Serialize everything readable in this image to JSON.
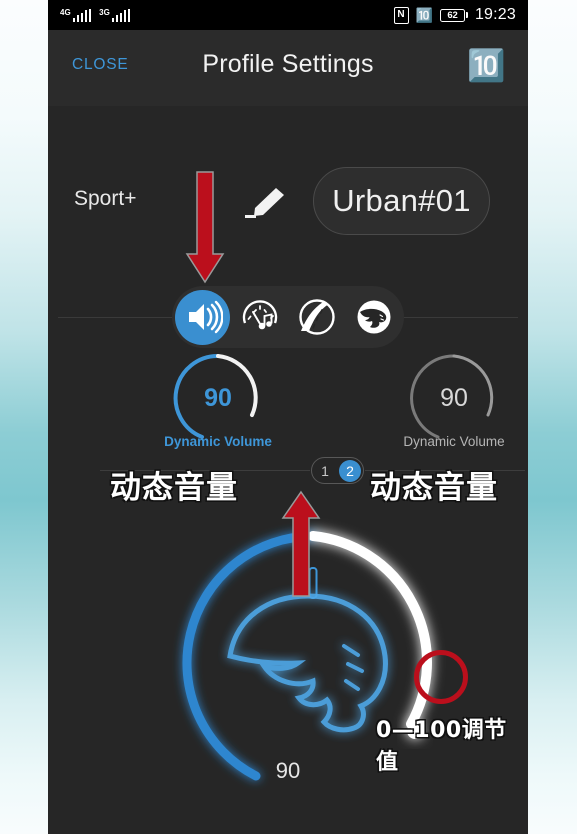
{
  "status_bar": {
    "network_1": "4G",
    "network_2": "3G",
    "nfc_label": "N",
    "bluetooth_icon": "bluetooth-icon",
    "battery_level": "62",
    "time": "19:23"
  },
  "header": {
    "close_label": "CLOSE",
    "title": "Profile Settings",
    "bluetooth_icon": "bluetooth-icon"
  },
  "profile": {
    "mode_label": "Sport+",
    "edit_icon": "pencil-icon",
    "profile_name": "Urban#01"
  },
  "tabs": [
    {
      "name": "speaker-icon",
      "label": "Volume",
      "active": true
    },
    {
      "name": "equalizer-gauge-icon",
      "label": "Sound",
      "active": false
    },
    {
      "name": "road-curve-icon",
      "label": "Road",
      "active": false
    },
    {
      "name": "panther-logo-icon",
      "label": "Brand",
      "active": false
    }
  ],
  "dials": [
    {
      "value": "90",
      "caption": "Dynamic Volume",
      "active": true
    },
    {
      "value": "90",
      "caption": "Dynamic Volume",
      "active": false
    }
  ],
  "pager": {
    "pages": [
      "1",
      "2"
    ],
    "selected": "2"
  },
  "main_dial": {
    "value": "90",
    "min": 0,
    "max": 100,
    "logo": "panther-head-logo"
  },
  "annotations": {
    "left_cn": "动态音量",
    "right_cn": "动态音量",
    "range_cn": "0—100调节值",
    "arrow_down": "red-down-arrow",
    "arrow_up": "red-up-arrow",
    "highlight_ring": "red-circle-highlight"
  },
  "colors": {
    "accent_blue": "#3a8fd0",
    "link_blue": "#3e96d8",
    "annotation_red": "#bb0f1c",
    "phone_bg": "#262626",
    "header_bg": "#2b2b2b"
  }
}
